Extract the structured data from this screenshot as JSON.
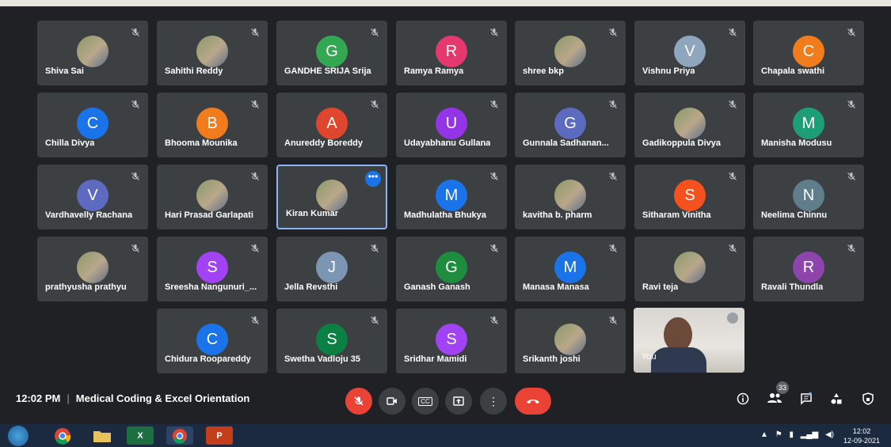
{
  "participants": [
    {
      "name": "Shiva Sai",
      "initial": "",
      "color": "",
      "photo": true
    },
    {
      "name": "Sahithi Reddy",
      "initial": "",
      "color": "",
      "photo": true
    },
    {
      "name": "GANDHE SRIJA Srija",
      "initial": "G",
      "color": "#33a852",
      "photo": false
    },
    {
      "name": "Ramya Ramya",
      "initial": "R",
      "color": "#e5386e",
      "photo": false
    },
    {
      "name": "shree bkp",
      "initial": "",
      "color": "",
      "photo": true
    },
    {
      "name": "Vishnu Priya",
      "initial": "V",
      "color": "#8fa6bf",
      "photo": false
    },
    {
      "name": "Chapala swathi",
      "initial": "C",
      "color": "#f07c1c",
      "photo": false
    },
    {
      "name": "Chilla Divya",
      "initial": "C",
      "color": "#1a73e8",
      "photo": false
    },
    {
      "name": "Bhooma Mounika",
      "initial": "B",
      "color": "#f07c1c",
      "photo": false
    },
    {
      "name": "Anureddy Boreddy",
      "initial": "A",
      "color": "#e0462d",
      "photo": false
    },
    {
      "name": "Udayabhanu Gullana",
      "initial": "U",
      "color": "#9334e6",
      "photo": false
    },
    {
      "name": "Gunnala Sadhanan...",
      "initial": "G",
      "color": "#5c6bc0",
      "photo": false
    },
    {
      "name": "Gadikoppula Divya",
      "initial": "",
      "color": "",
      "photo": true
    },
    {
      "name": "Manisha Modusu",
      "initial": "M",
      "color": "#1e9e74",
      "photo": false
    },
    {
      "name": "Vardhavelly Rachana",
      "initial": "V",
      "color": "#5c6bc0",
      "photo": false
    },
    {
      "name": "Hari Prasad Garlapati",
      "initial": "",
      "color": "",
      "photo": true
    },
    {
      "name": "Kiran Kumar",
      "initial": "",
      "color": "",
      "photo": true
    },
    {
      "name": "Madhulatha Bhukya",
      "initial": "M",
      "color": "#1a73e8",
      "photo": false
    },
    {
      "name": "kavitha b. pharm",
      "initial": "",
      "color": "",
      "photo": true
    },
    {
      "name": "Sitharam Vinitha",
      "initial": "S",
      "color": "#f4511e",
      "photo": false
    },
    {
      "name": "Neelima Chinnu",
      "initial": "N",
      "color": "#607d8b",
      "photo": false
    },
    {
      "name": "prathyusha prathyu",
      "initial": "",
      "color": "",
      "photo": true
    },
    {
      "name": "Sreesha Nangunuri_...",
      "initial": "S",
      "color": "#a142f4",
      "photo": false
    },
    {
      "name": "Jella Revsthi",
      "initial": "J",
      "color": "#7b95b3",
      "photo": false
    },
    {
      "name": "Ganash Ganash",
      "initial": "G",
      "color": "#1e8e3e",
      "photo": false
    },
    {
      "name": "Manasa Manasa",
      "initial": "M",
      "color": "#1a73e8",
      "photo": false
    },
    {
      "name": "Ravi teja",
      "initial": "",
      "color": "",
      "photo": true
    },
    {
      "name": "Ravali Thundla",
      "initial": "R",
      "color": "#8e44ad",
      "photo": false
    },
    {
      "name": "Chidura Roopareddy",
      "initial": "C",
      "color": "#1a73e8",
      "photo": false
    },
    {
      "name": "Swetha Vadloju 35",
      "initial": "S",
      "color": "#0b8043",
      "photo": false
    },
    {
      "name": "Sridhar Mamidi",
      "initial": "S",
      "color": "#a142f4",
      "photo": false
    },
    {
      "name": "Srikanth joshi",
      "initial": "",
      "color": "",
      "photo": true
    }
  ],
  "self_tile": {
    "name": "You"
  },
  "active_more_glyph": "•••",
  "bottom": {
    "time": "12:02 PM",
    "separator": "|",
    "meeting_title": "Medical Coding & Excel Orientation",
    "participants_count": "33",
    "cc_label": "CC"
  },
  "taskbar": {
    "excel_label": "X",
    "ppt_label": "P",
    "clock_time": "12:02",
    "clock_date": "12-09-2021"
  }
}
